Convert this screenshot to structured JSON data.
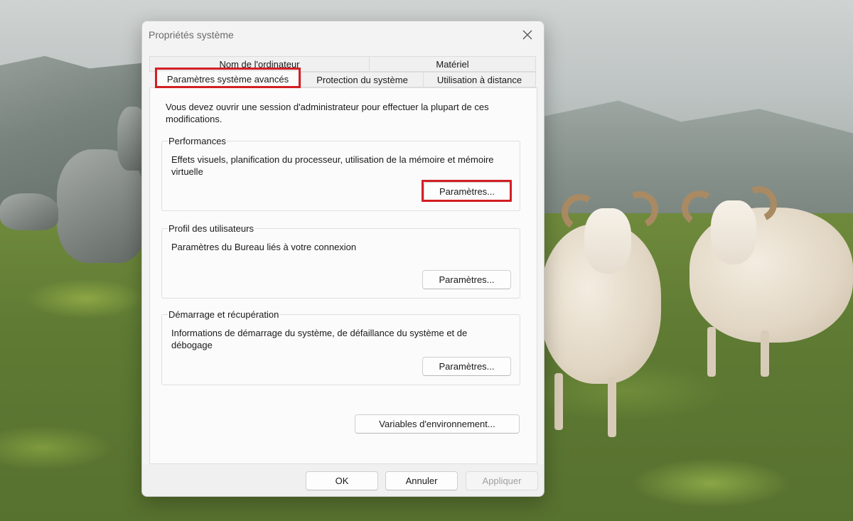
{
  "dialog": {
    "title": "Propriétés système",
    "tabs": [
      {
        "label": "Nom de l'ordinateur"
      },
      {
        "label": "Matériel"
      },
      {
        "label": "Paramètres système avancés",
        "active": true
      },
      {
        "label": "Protection du système"
      },
      {
        "label": "Utilisation à distance"
      }
    ],
    "intro": "Vous devez ouvrir une session d'administrateur pour effectuer la plupart de ces modifications.",
    "groups": {
      "performances": {
        "title": "Performances",
        "description": "Effets visuels, planification du processeur, utilisation de la mémoire et mémoire virtuelle",
        "button": "Paramètres..."
      },
      "user_profiles": {
        "title": "Profil des utilisateurs",
        "description": "Paramètres du Bureau liés à votre connexion",
        "button": "Paramètres..."
      },
      "startup_recovery": {
        "title": "Démarrage et récupération",
        "description": "Informations de démarrage du système, de défaillance du système et de débogage",
        "button": "Paramètres..."
      }
    },
    "env_button": "Variables d'environnement...",
    "footer": {
      "ok": "OK",
      "cancel": "Annuler",
      "apply": "Appliquer"
    }
  },
  "colors": {
    "highlight": "#d21f24",
    "dialog_bg": "#f3f3f3",
    "panel_bg": "#fbfbfb"
  },
  "icons": {
    "close": "close-icon"
  }
}
